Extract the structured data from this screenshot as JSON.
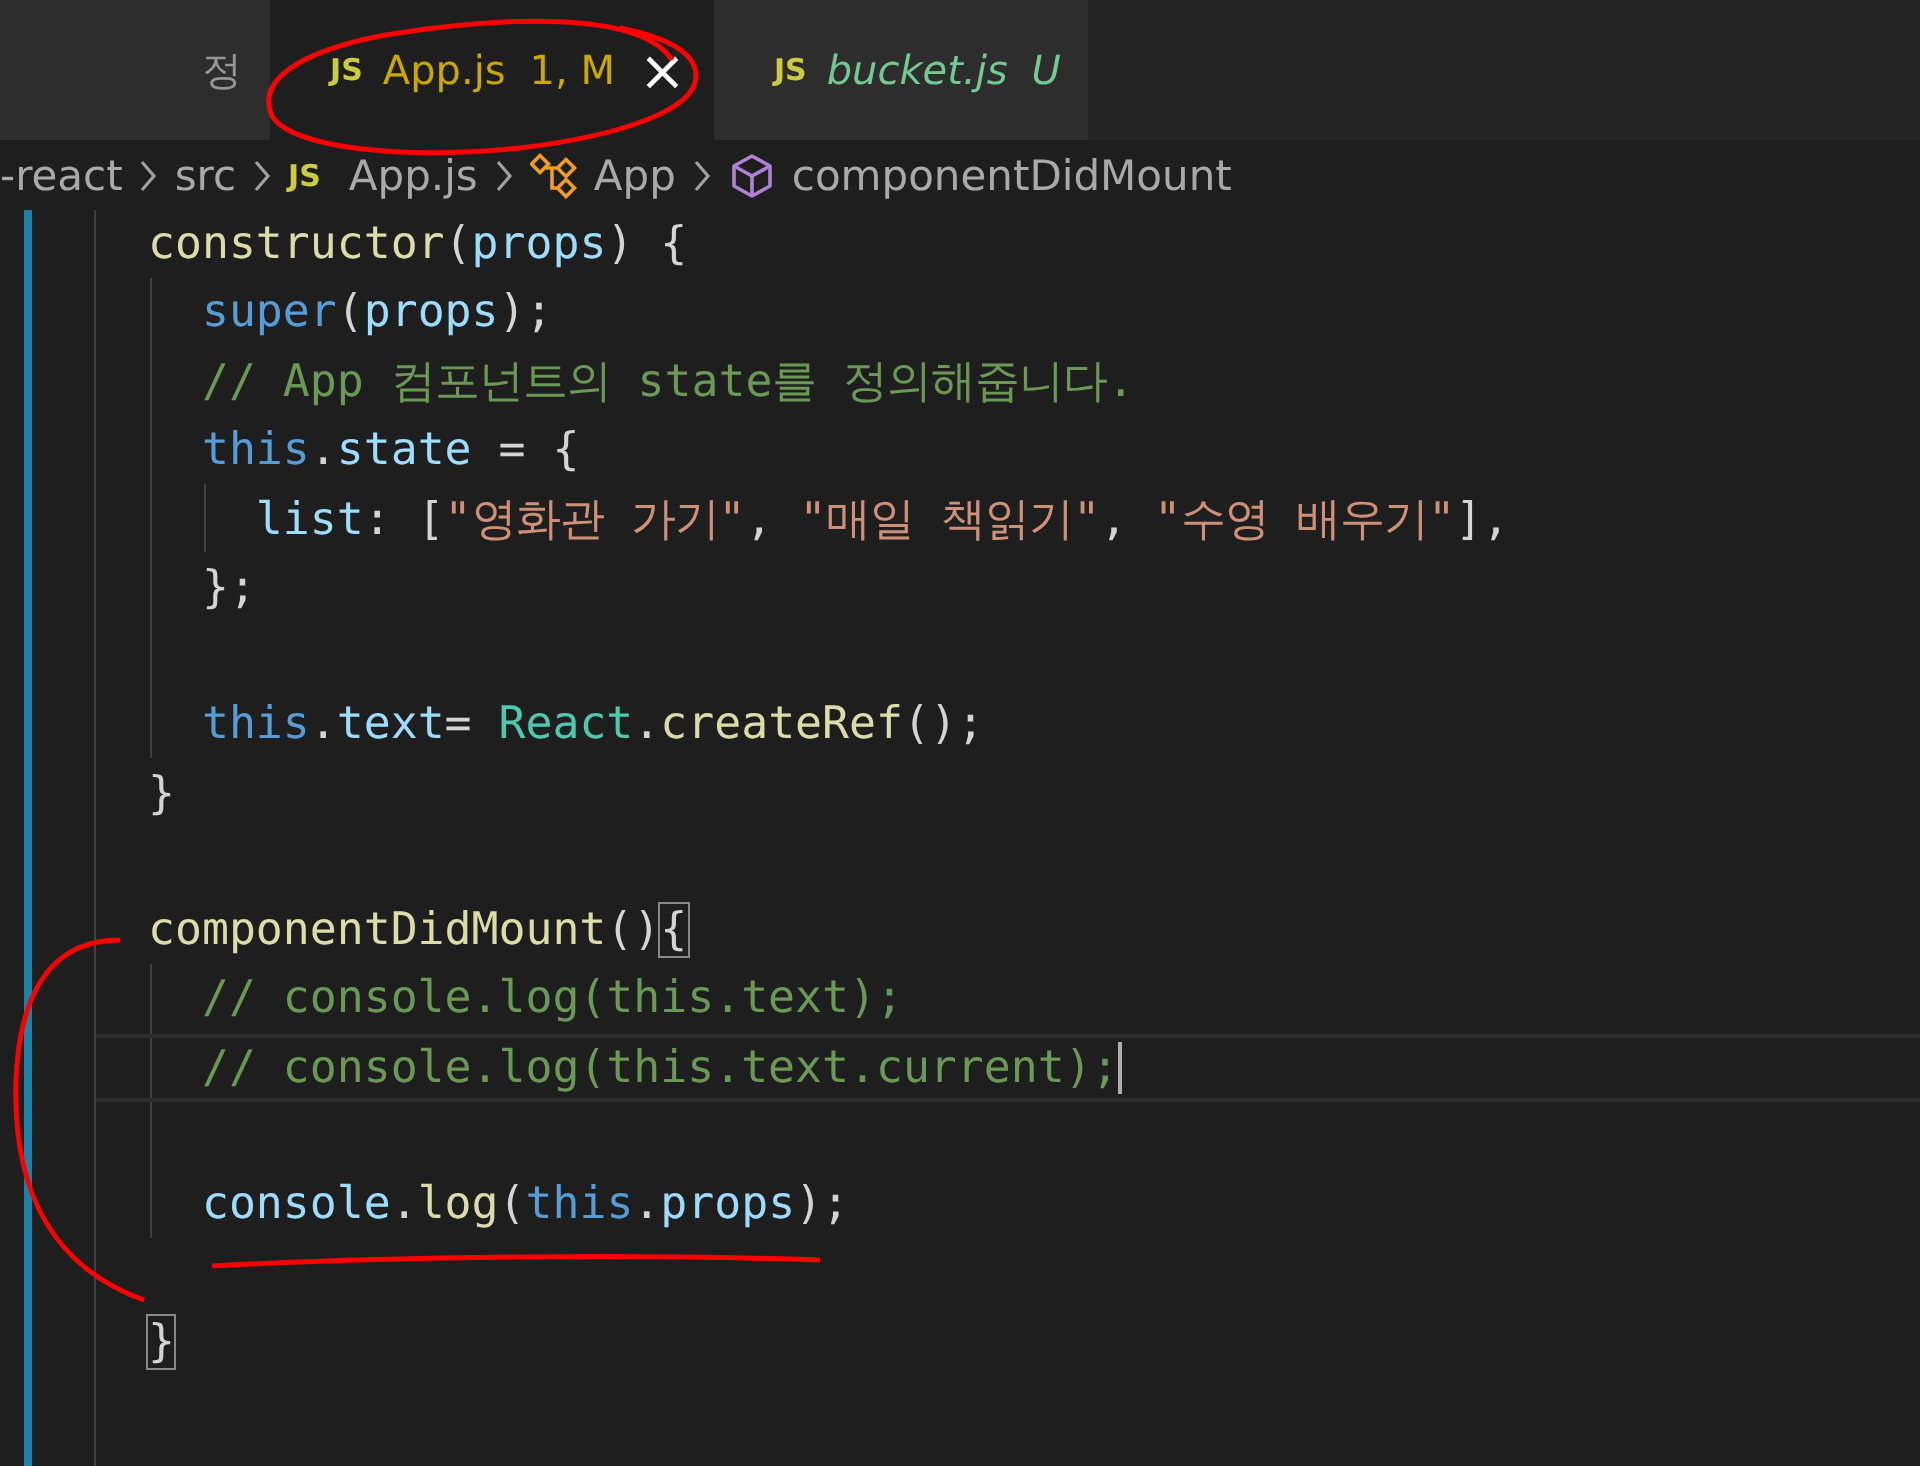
{
  "tabs": [
    {
      "label": "정",
      "selected": false,
      "preview": false,
      "color": "#969696"
    },
    {
      "icon_label": "JS",
      "label": "App.js",
      "badge": "1, M",
      "close": "×",
      "selected": true,
      "preview": false,
      "color": "#cca700"
    },
    {
      "icon_label": "JS",
      "label": "bucket.js",
      "badge": "U",
      "selected": false,
      "preview": true,
      "color": "#73c991"
    }
  ],
  "breadcrumbs": [
    {
      "kind": "folder",
      "label": "-react"
    },
    {
      "kind": "folder",
      "label": "src"
    },
    {
      "kind": "file",
      "icon_label": "JS",
      "label": "App.js"
    },
    {
      "kind": "class",
      "label": "App"
    },
    {
      "kind": "method",
      "label": "componentDidMount"
    }
  ],
  "code_lines": [
    {
      "current": false,
      "tokens": [
        {
          "kind": "fn",
          "text": "constructor"
        },
        {
          "kind": "p",
          "text": "("
        },
        {
          "kind": "var",
          "text": "props"
        },
        {
          "kind": "p",
          "text": ") {"
        }
      ]
    },
    {
      "current": false,
      "tokens": [
        {
          "kind": "kw",
          "text": "  super"
        },
        {
          "kind": "p",
          "text": "("
        },
        {
          "kind": "var",
          "text": "props"
        },
        {
          "kind": "p",
          "text": ");"
        }
      ]
    },
    {
      "current": false,
      "tokens": [
        {
          "kind": "cmt",
          "text": "  // App 컴포넌트의 state를 정의해줍니다."
        }
      ]
    },
    {
      "current": false,
      "tokens": [
        {
          "kind": "kw",
          "text": "  this"
        },
        {
          "kind": "p",
          "text": "."
        },
        {
          "kind": "var",
          "text": "state"
        },
        {
          "kind": "p",
          "text": " = {"
        }
      ]
    },
    {
      "current": false,
      "tokens": [
        {
          "kind": "var",
          "text": "    list"
        },
        {
          "kind": "p",
          "text": ": ["
        },
        {
          "kind": "str",
          "text": "\"영화관 가기\""
        },
        {
          "kind": "p",
          "text": ", "
        },
        {
          "kind": "str",
          "text": "\"매일 책읽기\""
        },
        {
          "kind": "p",
          "text": ", "
        },
        {
          "kind": "str",
          "text": "\"수영 배우기\""
        },
        {
          "kind": "p",
          "text": "],"
        }
      ]
    },
    {
      "current": false,
      "tokens": [
        {
          "kind": "p",
          "text": "  };"
        }
      ]
    },
    {
      "current": false
    },
    {
      "current": false,
      "tokens": [
        {
          "kind": "kw",
          "text": "  this"
        },
        {
          "kind": "p",
          "text": "."
        },
        {
          "kind": "var",
          "text": "text"
        },
        {
          "kind": "p",
          "text": "= "
        },
        {
          "kind": "cls",
          "text": "React"
        },
        {
          "kind": "p",
          "text": "."
        },
        {
          "kind": "fn",
          "text": "createRef"
        },
        {
          "kind": "p",
          "text": "();"
        }
      ]
    },
    {
      "current": false,
      "tokens": [
        {
          "kind": "p",
          "text": "}"
        }
      ]
    },
    {
      "current": false
    },
    {
      "current": false,
      "tokens": [
        {
          "kind": "fn",
          "text": "componentDidMount"
        },
        {
          "kind": "p",
          "text": "()"
        },
        {
          "kind": "bracket",
          "text": "{"
        }
      ]
    },
    {
      "current": false,
      "tokens": [
        {
          "kind": "cmt",
          "text": "  // console.log(this.text);"
        }
      ]
    },
    {
      "current": true,
      "tokens": [
        {
          "kind": "cmt",
          "text": "  // console.log(this.text.current);"
        }
      ]
    },
    {
      "current": false
    },
    {
      "current": false,
      "tokens": [
        {
          "kind": "var",
          "text": "  console"
        },
        {
          "kind": "p",
          "text": "."
        },
        {
          "kind": "fn",
          "text": "log"
        },
        {
          "kind": "p",
          "text": "("
        },
        {
          "kind": "kw",
          "text": "this"
        },
        {
          "kind": "p",
          "text": "."
        },
        {
          "kind": "var",
          "text": "props"
        },
        {
          "kind": "p",
          "text": ");"
        }
      ]
    },
    {
      "current": false
    },
    {
      "current": false,
      "tokens": [
        {
          "kind": "bracket",
          "text": "}"
        }
      ]
    }
  ]
}
